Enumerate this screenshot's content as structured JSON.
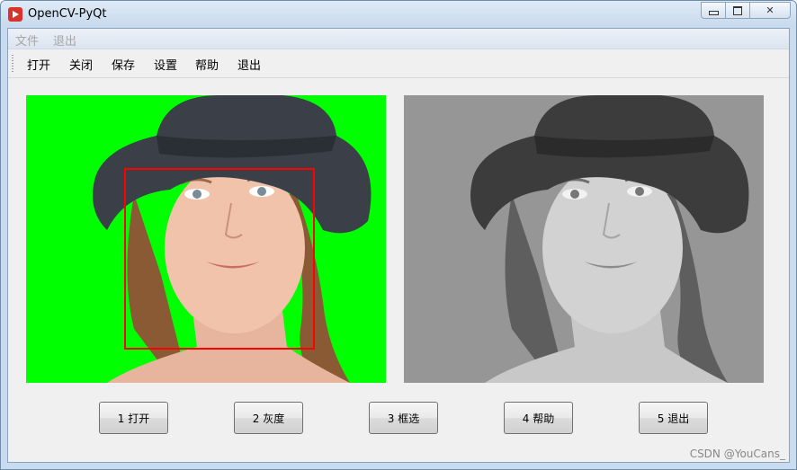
{
  "window": {
    "title": "OpenCV-PyQt",
    "controls": [
      "minimize",
      "maximize",
      "close"
    ]
  },
  "menubar": {
    "items": [
      "文件",
      "退出"
    ]
  },
  "toolbar": {
    "items": [
      "打开",
      "关闭",
      "保存",
      "设置",
      "帮助",
      "退出"
    ]
  },
  "images": {
    "left": {
      "description": "color photo on green background with red face detection box",
      "bg_color": "#00ff00",
      "box_color": "#ff0000"
    },
    "right": {
      "description": "grayscale version of the photo",
      "bg_color": "#969696"
    }
  },
  "buttons": [
    "1 打开",
    "2 灰度",
    "3 框选",
    "4 帮助",
    "5 退出"
  ],
  "watermark": "CSDN @YouCans_"
}
